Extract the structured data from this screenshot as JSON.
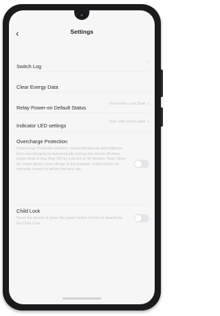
{
  "header": {
    "back_icon": "chevron-left-icon",
    "title": "Settings"
  },
  "rows": {
    "switch_log": {
      "label": "Switch Log",
      "chevron_icon": "chevron-right-icon"
    },
    "clear_energy": {
      "label": "Clear Energy Data"
    },
    "relay_power_on": {
      "label": "Relay Power-on Default Status",
      "value": "Remember Last State"
    },
    "indicator_led": {
      "label": "Indicator LED settings",
      "value": "Sync with switch state"
    }
  },
  "overcharge": {
    "title": "Overcharge Protection",
    "description": "Overcharge Protection protects connected devices and batteries from overcharging by automatically turning this device off when power draw is less than 3W for a period of 40 minutes. Note: Once the smart device turns off due to this function, it will need to be manually turned on before the next use.",
    "enabled": false
  },
  "child_lock": {
    "title": "Child Lock",
    "description": "Reset the device or press the power button 4 times to deactivate the Child Lock.",
    "enabled": false
  },
  "colors": {
    "background": "#f6f6f7",
    "toggle_off": "#e4e6ea",
    "frame": "#1b1b1d"
  }
}
